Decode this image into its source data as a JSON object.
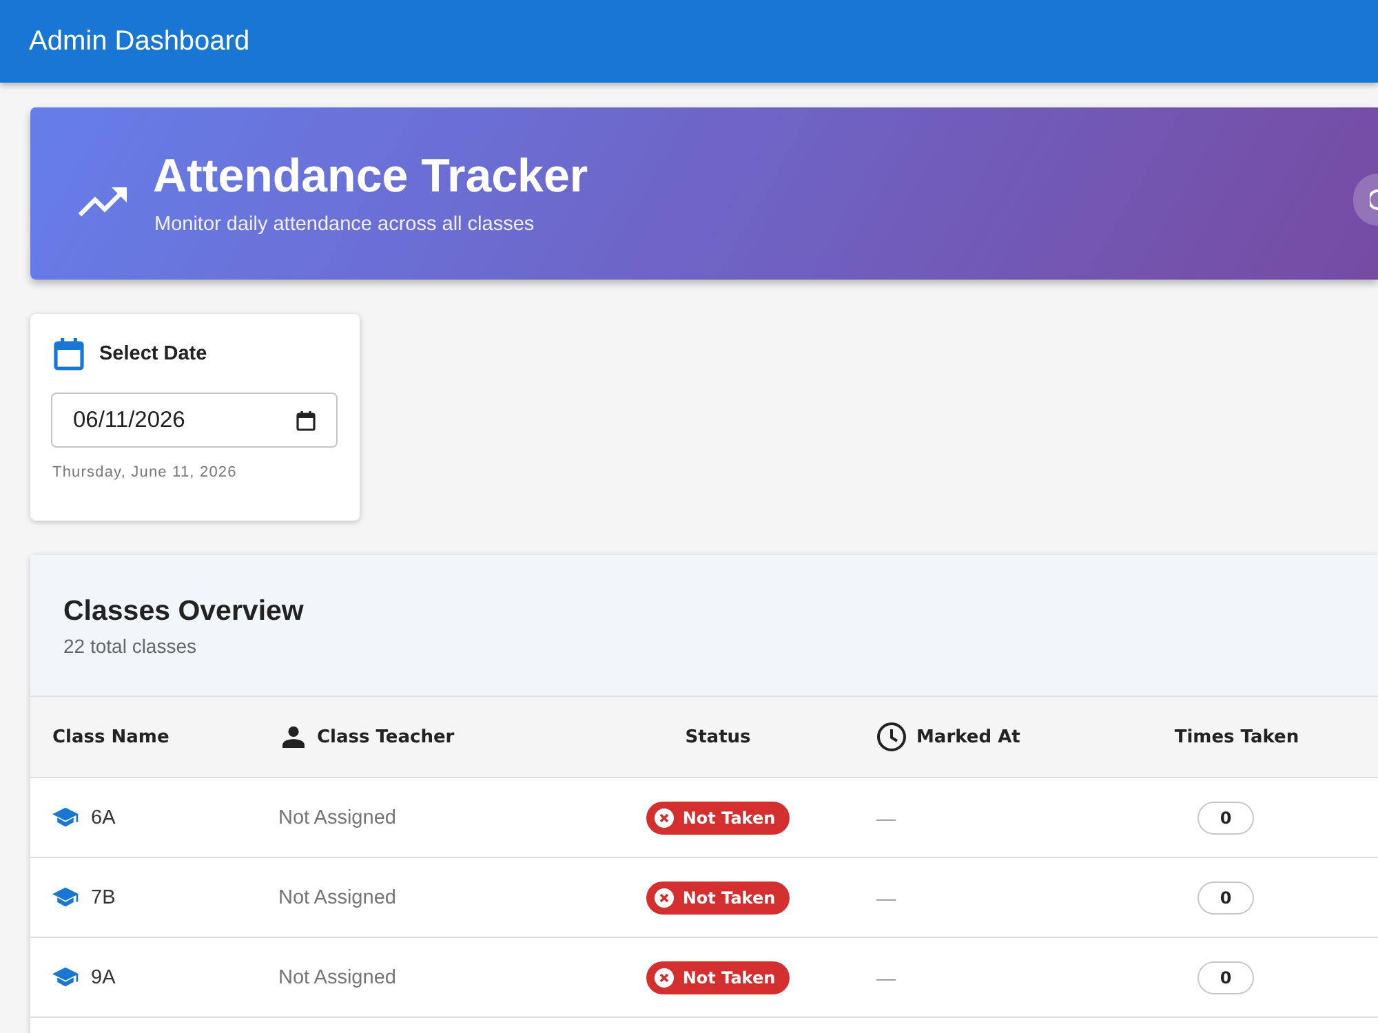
{
  "app_bar": {
    "title": "Admin Dashboard"
  },
  "hero": {
    "title": "Attendance Tracker",
    "subtitle": "Monitor daily attendance across all classes"
  },
  "date_card": {
    "label": "Select Date",
    "value": "06/11/2026",
    "helper": "Thursday, June 11, 2026"
  },
  "classes": {
    "title": "Classes Overview",
    "subtitle": "22 total classes",
    "columns": [
      {
        "label": "Class Name"
      },
      {
        "label": "Class Teacher"
      },
      {
        "label": "Status"
      },
      {
        "label": "Marked At"
      },
      {
        "label": "Times Taken"
      }
    ],
    "rows": [
      {
        "class_name": "6A",
        "teacher": "Not Assigned",
        "status": {
          "label": "Not Taken",
          "kind": "not_taken"
        },
        "marked_at": "—",
        "times_taken": "0"
      },
      {
        "class_name": "7B",
        "teacher": "Not Assigned",
        "status": {
          "label": "Not Taken",
          "kind": "not_taken"
        },
        "marked_at": "—",
        "times_taken": "0"
      },
      {
        "class_name": "9A",
        "teacher": "Not Assigned",
        "status": {
          "label": "Not Taken",
          "kind": "not_taken"
        },
        "marked_at": "—",
        "times_taken": "0"
      }
    ]
  }
}
